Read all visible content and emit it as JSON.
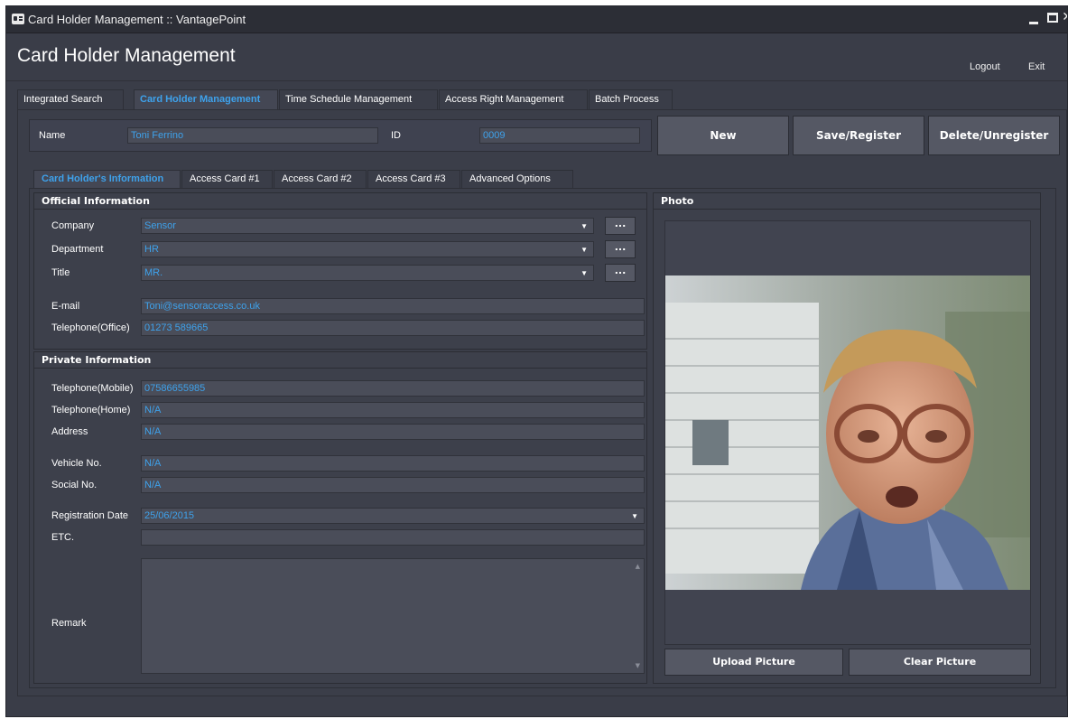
{
  "window": {
    "title": "Card Holder Management :: VantagePoint"
  },
  "header": {
    "title": "Card Holder Management",
    "logout": "Logout",
    "exit": "Exit"
  },
  "main_tabs": [
    {
      "label": "Integrated Search"
    },
    {
      "label": "Card Holder Management"
    },
    {
      "label": "Time Schedule Management"
    },
    {
      "label": "Access Right Management"
    },
    {
      "label": "Batch Process"
    }
  ],
  "top": {
    "name_label": "Name",
    "name_value": "Toni Ferrino",
    "id_label": "ID",
    "id_value": "0009",
    "new_btn": "New",
    "save_btn": "Save/Register",
    "delete_btn": "Delete/Unregister"
  },
  "sub_tabs": [
    {
      "label": "Card Holder's Information"
    },
    {
      "label": "Access Card #1"
    },
    {
      "label": "Access Card #2"
    },
    {
      "label": "Access Card #3"
    },
    {
      "label": "Advanced Options"
    }
  ],
  "official": {
    "title": "Official Information",
    "company_label": "Company",
    "company_value": "Sensor",
    "department_label": "Department",
    "department_value": "HR",
    "title_label": "Title",
    "title_value": "MR.",
    "email_label": "E-mail",
    "email_value": "Toni@sensoraccess.co.uk",
    "phone_label": "Telephone(Office)",
    "phone_value": "01273 589665",
    "ellipsis": "..."
  },
  "private": {
    "title": "Private Information",
    "mobile_label": "Telephone(Mobile)",
    "mobile_value": "07586655985",
    "home_label": "Telephone(Home)",
    "home_value": "N/A",
    "address_label": "Address",
    "address_value": "N/A",
    "vehicle_label": "Vehicle No.",
    "vehicle_value": "N/A",
    "social_label": "Social No.",
    "social_value": "N/A",
    "regdate_label": "Registration Date",
    "regdate_value": "25/06/2015",
    "etc_label": "ETC.",
    "etc_value": "",
    "remark_label": "Remark",
    "remark_value": ""
  },
  "photo": {
    "title": "Photo",
    "upload_btn": "Upload Picture",
    "clear_btn": "Clear Picture"
  },
  "icons": {
    "app": "id-card-icon",
    "dropdown": "triangle-down-icon"
  },
  "colors": {
    "accent": "#3ea2ec",
    "background": "#3a3d48",
    "button": "#555864"
  }
}
